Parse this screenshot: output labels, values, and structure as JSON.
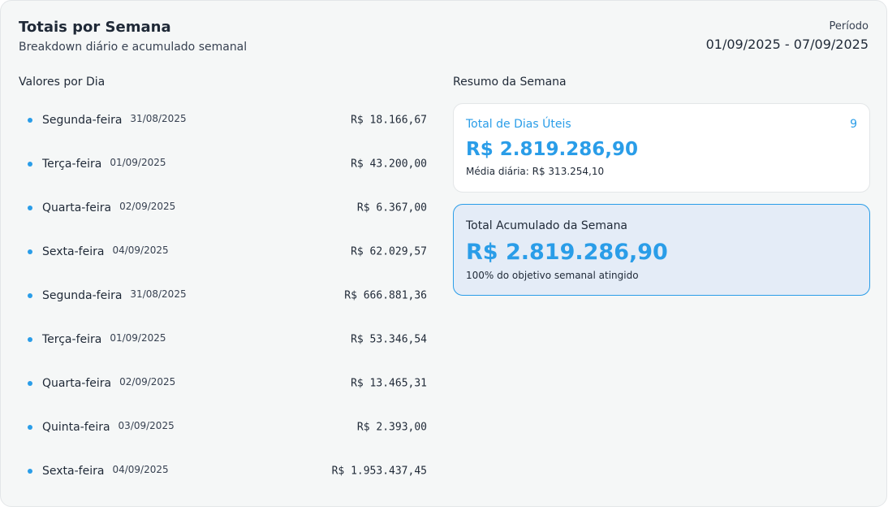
{
  "header": {
    "title": "Totais por Semana",
    "subtitle": "Breakdown diário e acumulado semanal",
    "period_label": "Período",
    "period_value": "01/09/2025 - 07/09/2025"
  },
  "daily": {
    "section_title": "Valores por Dia",
    "rows": [
      {
        "day": "Segunda-feira",
        "date": "31/08/2025",
        "amount": "R$ 18.166,67"
      },
      {
        "day": "Terça-feira",
        "date": "01/09/2025",
        "amount": "R$ 43.200,00"
      },
      {
        "day": "Quarta-feira",
        "date": "02/09/2025",
        "amount": "R$ 6.367,00"
      },
      {
        "day": "Sexta-feira",
        "date": "04/09/2025",
        "amount": "R$ 62.029,57"
      },
      {
        "day": "Segunda-feira",
        "date": "31/08/2025",
        "amount": "R$ 666.881,36"
      },
      {
        "day": "Terça-feira",
        "date": "01/09/2025",
        "amount": "R$ 53.346,54"
      },
      {
        "day": "Quarta-feira",
        "date": "02/09/2025",
        "amount": "R$ 13.465,31"
      },
      {
        "day": "Quinta-feira",
        "date": "03/09/2025",
        "amount": "R$ 2.393,00"
      },
      {
        "day": "Sexta-feira",
        "date": "04/09/2025",
        "amount": "R$ 1.953.437,45"
      }
    ]
  },
  "summary": {
    "section_title": "Resumo da Semana",
    "business_days": {
      "label": "Total de Dias Úteis",
      "count": "9",
      "total": "R$ 2.819.286,90",
      "average": "Média diária: R$ 313.254,10"
    },
    "accumulated": {
      "label": "Total Acumulado da Semana",
      "total": "R$ 2.819.286,90",
      "note": "100% do objetivo semanal atingido"
    }
  },
  "colors": {
    "accent": "#2a9de8",
    "card_bg": "#f5f7f7",
    "highlight_bg": "#e4ecf7"
  }
}
